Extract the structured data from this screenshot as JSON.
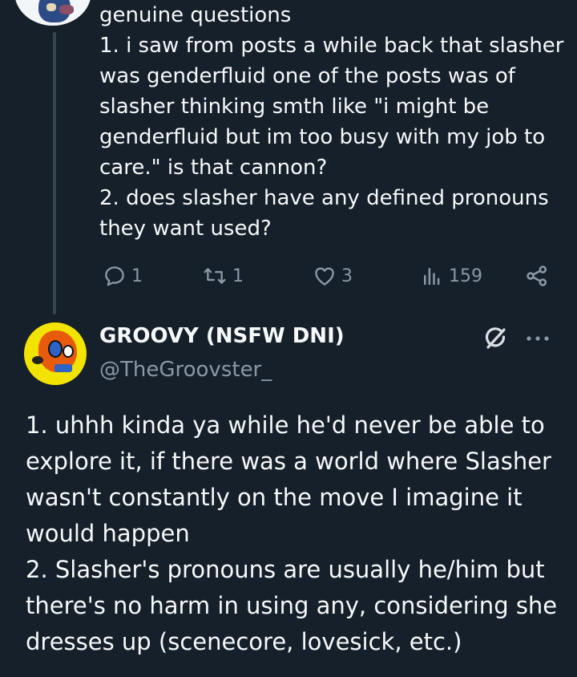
{
  "previous_tweet": {
    "lines": [
      "genuine questions",
      "1. i saw from posts a while back that slasher",
      "was genderfluid one of the posts was of",
      "slasher thinking smth like \"i might be",
      "genderfluid but im too busy with my job to",
      "care.\" is that cannon?",
      "2. does slasher have any defined pronouns",
      "they want used?"
    ],
    "actions": {
      "replies": "1",
      "reposts": "1",
      "likes": "3",
      "views": "159"
    }
  },
  "reply_tweet": {
    "display_name": "GROOVY (NSFW DNI)",
    "handle": "@TheGroovster_",
    "lines": [
      "1. uhhh kinda ya while he'd never be able to",
      "explore it, if there was a world where Slasher",
      "wasn't constantly on the move I imagine it",
      "would happen",
      "2. Slasher's pronouns are usually he/him but",
      "there's no harm in using any, considering she",
      "dresses up (scenecore, lovesick, etc.)"
    ]
  },
  "colors": {
    "background": "#15202b",
    "text": "#f7f9f9",
    "muted": "#8b98a5",
    "thread_line": "#38444d"
  },
  "icons": {
    "reply": "reply-icon",
    "repost": "repost-icon",
    "like": "heart-icon",
    "views": "views-icon",
    "share": "share-icon",
    "grok": "grok-icon",
    "more": "more-icon"
  }
}
